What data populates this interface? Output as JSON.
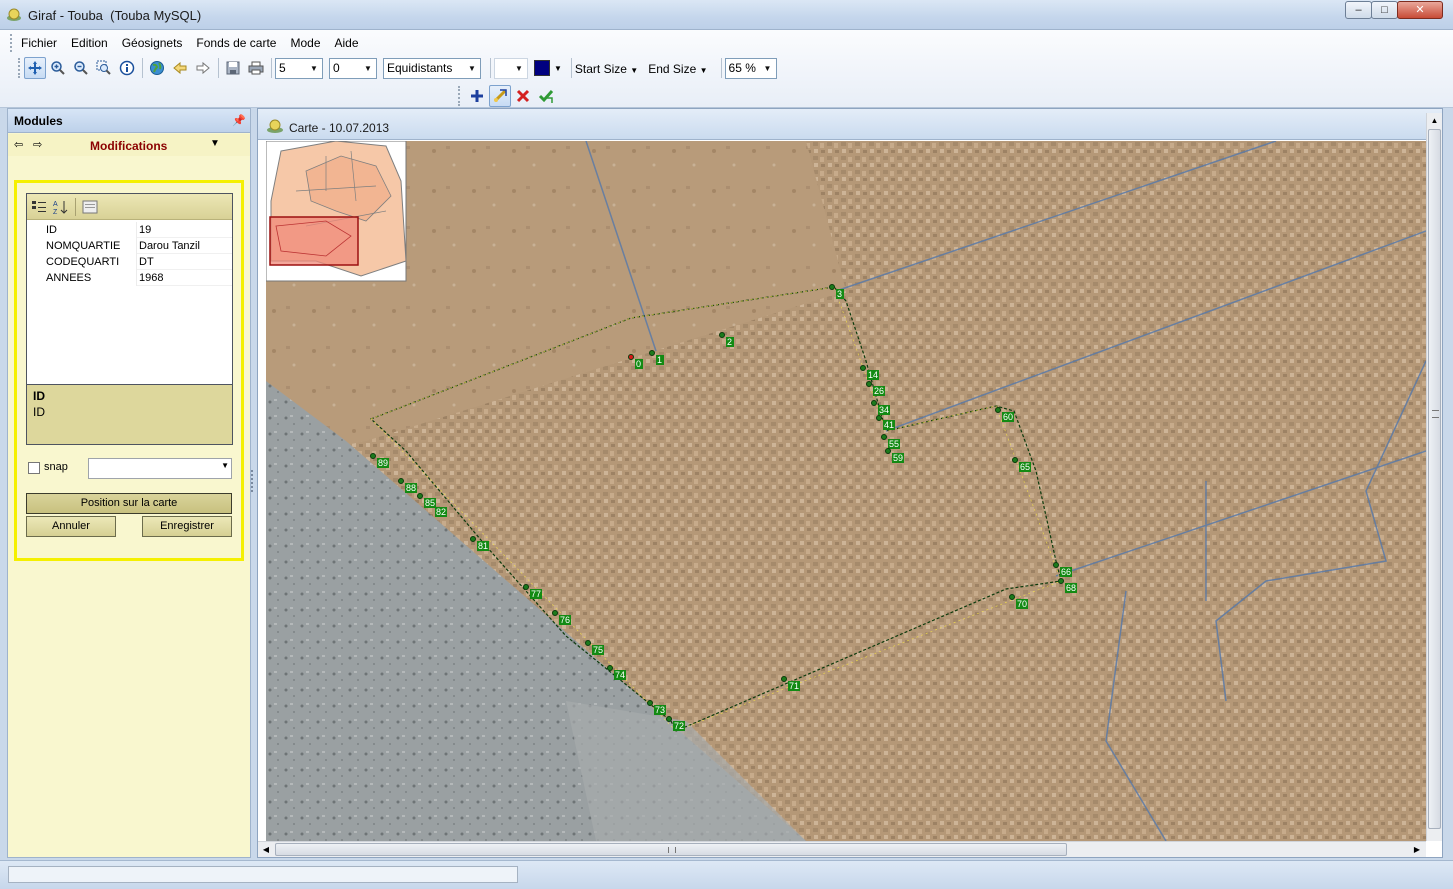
{
  "window": {
    "title": "Giraf - Touba  (Touba MySQL)",
    "controls": {
      "minimize": "–",
      "maximize": "□",
      "close": "✕"
    }
  },
  "menu": [
    "Fichier",
    "Edition",
    "Géosignets",
    "Fonds de carte",
    "Mode",
    "Aide"
  ],
  "toolbar": {
    "classes_value": "5",
    "precision_value": "0",
    "method_value": "Equidistants",
    "color_hex": "#000080",
    "start_size_label": "Start Size",
    "end_size_label": "End Size",
    "zoom_value": "65 %"
  },
  "modules": {
    "title": "Modules",
    "current_module": "Modifications",
    "properties": [
      {
        "key": "ID",
        "value": "19"
      },
      {
        "key": "NOMQUARTIE",
        "value": "Darou Tanzil"
      },
      {
        "key": "CODEQUARTI",
        "value": "DT"
      },
      {
        "key": "ANNEES",
        "value": "1968"
      }
    ],
    "description_title": "ID",
    "description_text": "ID",
    "snap_label": "snap",
    "position_button": "Position sur la carte",
    "cancel_button": "Annuler",
    "save_button": "Enregistrer"
  },
  "map": {
    "title": "Carte - 10.07.2013",
    "vertex_labels": [
      {
        "text": "0"
      },
      {
        "text": "1"
      },
      {
        "text": "2"
      },
      {
        "text": "3"
      },
      {
        "text": "14"
      },
      {
        "text": "26"
      },
      {
        "text": "34"
      },
      {
        "text": "41"
      },
      {
        "text": "55"
      },
      {
        "text": "59"
      },
      {
        "text": "60"
      },
      {
        "text": "65"
      },
      {
        "text": "66"
      },
      {
        "text": "68"
      },
      {
        "text": "70"
      },
      {
        "text": "71"
      },
      {
        "text": "72"
      },
      {
        "text": "73"
      },
      {
        "text": "74"
      },
      {
        "text": "75"
      },
      {
        "text": "76"
      },
      {
        "text": "77"
      },
      {
        "text": "81"
      },
      {
        "text": "82"
      },
      {
        "text": "85"
      },
      {
        "text": "88"
      },
      {
        "text": "89"
      }
    ]
  }
}
